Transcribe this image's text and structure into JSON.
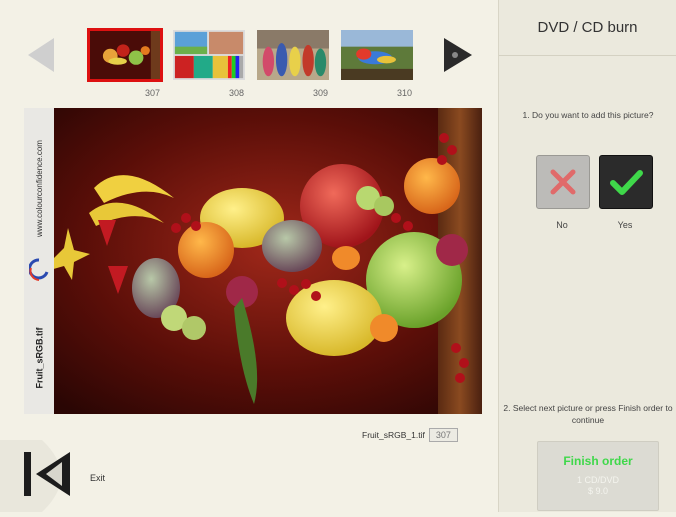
{
  "right_panel": {
    "title": "DVD / CD burn",
    "question1": "1. Do you want to add this picture?",
    "no_label": "No",
    "yes_label": "Yes",
    "question2": "2. Select next picture or press Finish order to continue",
    "finish_button": {
      "label": "Finish order",
      "media": "1 CD/DVD",
      "price": "$ 9.0"
    }
  },
  "thumbnails": [
    {
      "number": "307",
      "selected": true
    },
    {
      "number": "308",
      "selected": false
    },
    {
      "number": "309",
      "selected": false
    },
    {
      "number": "310",
      "selected": false
    }
  ],
  "preview": {
    "side_url": "www.colourconfidence.com",
    "side_filename": "Fruit_sRGB.tif"
  },
  "file_info": {
    "filename": "Fruit_sRGB_1.tif",
    "number": "307"
  },
  "exit_label": "Exit",
  "icons": {
    "prev": "arrow-left-icon",
    "next": "arrow-right-icon",
    "exit": "skip-back-icon",
    "no": "x-icon",
    "yes": "check-icon"
  },
  "colors": {
    "accent_green": "#3fd84a",
    "selected_border": "#dd1111",
    "no_cross": "#e06a6a"
  }
}
